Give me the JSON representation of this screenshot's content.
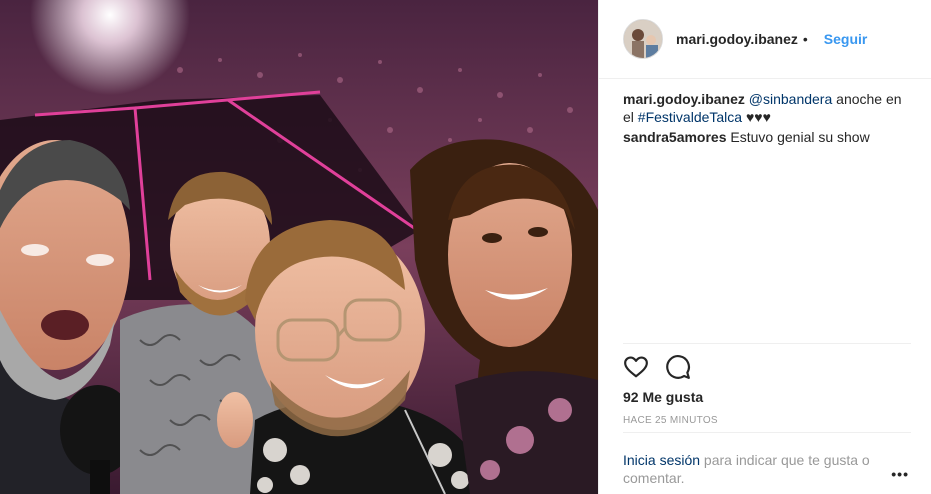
{
  "post": {
    "image_alt": "",
    "author": {
      "username": "mari.godoy.ibanez",
      "separator": "•",
      "follow_label": "Seguir"
    },
    "caption": {
      "username": "mari.godoy.ibanez",
      "mention": "@sinbandera",
      "text_1": " anoche en el ",
      "hashtag": "#FestivaldeTalca",
      "text_2": " ♥♥♥"
    },
    "comments": [
      {
        "username": "sandra5amores",
        "text": " Estuvo genial su show"
      }
    ],
    "actions": {
      "like_icon": "heart-outline-icon",
      "comment_icon": "speech-bubble-icon"
    },
    "likes": "92 Me gusta",
    "timestamp": "HACE 25 MINUTOS",
    "footer": {
      "login_link": "Inicia sesión",
      "prompt": " para indicar que te gusta o comentar.",
      "more_label": "•••"
    }
  },
  "colors": {
    "accent": "#3897f0",
    "link": "#003569",
    "muted": "#999999",
    "text": "#262626",
    "stage_light": "#e0409a"
  }
}
